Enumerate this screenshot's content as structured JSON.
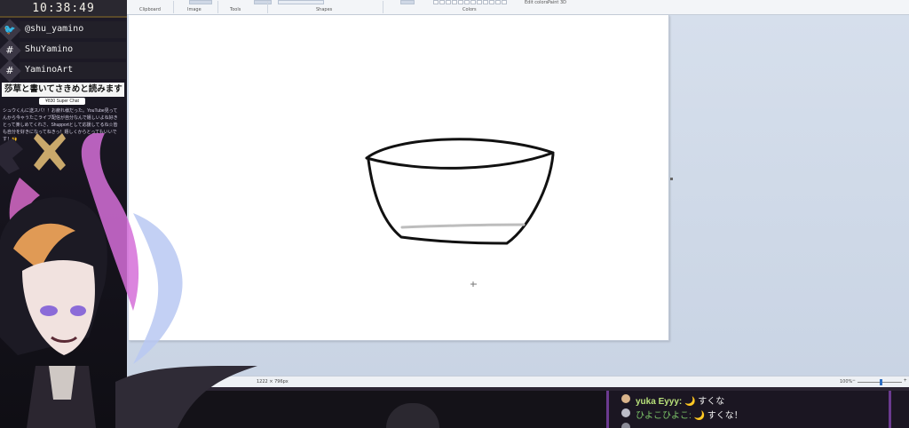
{
  "clock": {
    "time": "10:38:49"
  },
  "socials": [
    {
      "icon": "twitter-icon",
      "glyph": "🐦",
      "text": "@shu_yamino"
    },
    {
      "icon": "hashtag-icon",
      "glyph": "#",
      "text": "ShuYamino"
    },
    {
      "icon": "hashtag-icon",
      "glyph": "#",
      "text": "YaminoArt"
    }
  ],
  "superchat": {
    "title": "莎草と書いてさきめと読みます",
    "badge": "¥830 Super Chat",
    "message": "シュウくんに送スパ！！お疲れ様だった。YouTube見ってんから今ゃうたこライブ配信が自分なんで嬉しいよね好きとって楽しめてくれさ、Shupportとして応援してるね☆皆も自分を好きになってねきっ！嬉しくからとってもいいです！🙌"
  },
  "paint": {
    "groups": [
      "Clipboard",
      "Image",
      "Tools",
      "Shapes",
      "Colors"
    ],
    "extra_labels": [
      "Edit colors",
      "Paint 3D"
    ],
    "status": {
      "dimensions": "1222 × 796px",
      "zoom": "100%"
    }
  },
  "chat": [
    {
      "name": "yuka Eyyy:",
      "emoji": "🌙",
      "message": "すくな",
      "avatar_color": "#d9b38a"
    },
    {
      "name": "ひよこひよこ:",
      "emoji": "🌙",
      "message": "すくな！",
      "avatar_color": "#bcbcc8"
    }
  ]
}
